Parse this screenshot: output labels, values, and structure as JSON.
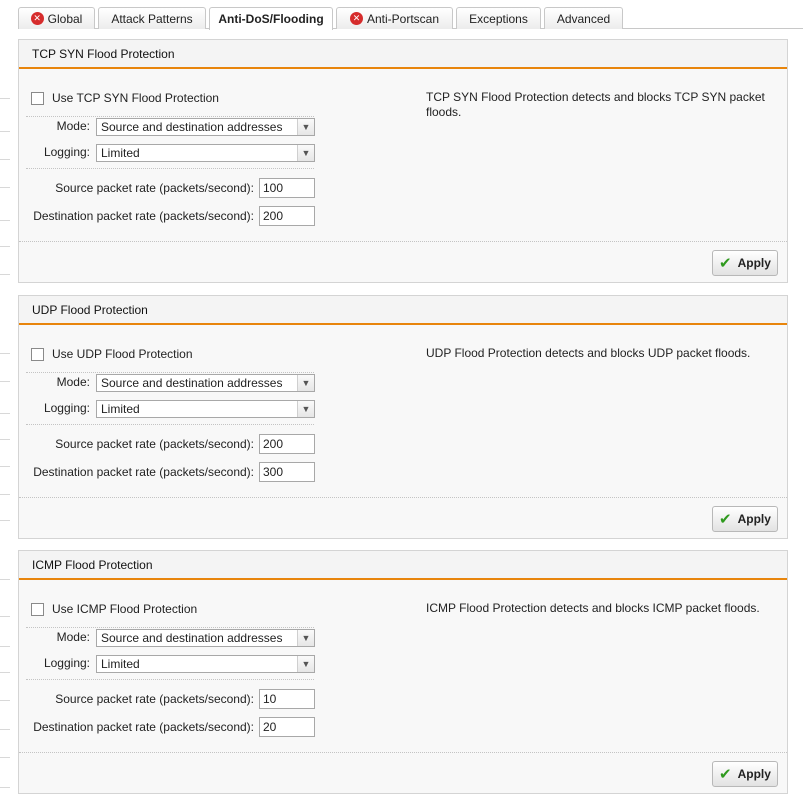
{
  "tabs": [
    {
      "label": "Global",
      "icon": "error-icon",
      "active": false
    },
    {
      "label": "Attack Patterns",
      "active": false
    },
    {
      "label": "Anti-DoS/Flooding",
      "active": true
    },
    {
      "label": "Anti-Portscan",
      "icon": "error-icon",
      "active": false
    },
    {
      "label": "Exceptions",
      "active": false
    },
    {
      "label": "Advanced",
      "active": false
    }
  ],
  "panels": [
    {
      "title": "TCP SYN Flood Protection",
      "checkbox_label": "Use TCP SYN Flood Protection",
      "checked": false,
      "description": "TCP SYN Flood Protection detects and blocks TCP SYN packet floods.",
      "mode_label": "Mode:",
      "mode_value": "Source and destination addresses",
      "logging_label": "Logging:",
      "logging_value": "Limited",
      "source_rate_label": "Source packet rate (packets/second):",
      "source_rate_value": "100",
      "dest_rate_label": "Destination packet rate (packets/second):",
      "dest_rate_value": "200",
      "apply_label": "Apply"
    },
    {
      "title": "UDP Flood Protection",
      "checkbox_label": "Use UDP Flood Protection",
      "checked": false,
      "description": "UDP Flood Protection detects and blocks UDP packet floods.",
      "mode_label": "Mode:",
      "mode_value": "Source and destination addresses",
      "logging_label": "Logging:",
      "logging_value": "Limited",
      "source_rate_label": "Source packet rate (packets/second):",
      "source_rate_value": "200",
      "dest_rate_label": "Destination packet rate (packets/second):",
      "dest_rate_value": "300",
      "apply_label": "Apply"
    },
    {
      "title": "ICMP Flood Protection",
      "checkbox_label": "Use ICMP Flood Protection",
      "checked": false,
      "description": "ICMP Flood Protection detects and blocks ICMP packet floods.",
      "mode_label": "Mode:",
      "mode_value": "Source and destination addresses",
      "logging_label": "Logging:",
      "logging_value": "Limited",
      "source_rate_label": "Source packet rate (packets/second):",
      "source_rate_value": "10",
      "dest_rate_label": "Destination packet rate (packets/second):",
      "dest_rate_value": "20",
      "apply_label": "Apply"
    }
  ],
  "colors": {
    "accent": "#e8850c",
    "error": "#d62c2c",
    "apply_check": "#2f9a1e"
  }
}
